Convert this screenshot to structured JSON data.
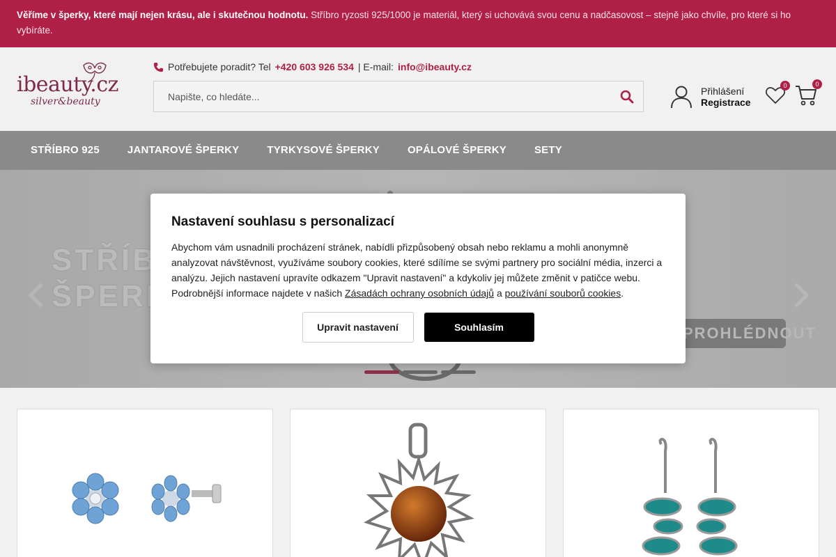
{
  "promo": {
    "bold": "Věříme v šperky, které mají nejen krásu, ale i skutečnou hodnotu.",
    "text": " Stříbro ryzosti 925/1000 je materiál, který si uchovává svou cenu a nadčasovost – stejně jako chvíle, pro které si ho vybíráte."
  },
  "logo": {
    "main": "ibeauty.cz",
    "sub": "silver&beauty"
  },
  "contact": {
    "question": "Potřebujete poradit? Tel",
    "phone": "+420 603 926 534",
    "separator": "| E-mail:",
    "email": "info@ibeauty.cz"
  },
  "search": {
    "placeholder": "Napište, co hledáte..."
  },
  "account": {
    "login": "Přihlášení",
    "register": "Registrace"
  },
  "wishlist": {
    "count": "0"
  },
  "cart": {
    "count": "0"
  },
  "nav": [
    "STŘÍBRO 925",
    "JANTAROVÉ ŠPERKY",
    "TYRKYSOVÉ ŠPERKY",
    "OPÁLOVÉ ŠPERKY",
    "SETY"
  ],
  "hero": {
    "title_line1": "STŘÍBRNÉ",
    "title_line2": "ŠPERKY",
    "cta": "PROHLÉDNOUT",
    "slides": 3,
    "active_slide": 1
  },
  "modal": {
    "title": "Nastavení souhlasu s personalizací",
    "text": "Abychom vám usnadnili procházení stránek, nabídli přizpůsobený obsah nebo reklamu a mohli anonymně analyzovat návštěvnost, využíváme soubory cookies, které sdílíme se svými partnery pro sociální média, inzerci a analýzu. Jejich nastavení upravíte odkazem \"Upravit nastavení\" a kdykoliv jej můžete změnit v patičce webu. Podrobnější informace najdete v našich ",
    "link1": "Zásadách ochrany osobních údajů",
    "and": " a ",
    "link2": "používání souborů cookies",
    "end": ".",
    "settings_button": "Upravit nastavení",
    "accept_button": "Souhlasím"
  },
  "colors": {
    "brand": "#b01f45",
    "nav": "#8a8a8a",
    "header_bg": "#f1f1f1"
  },
  "products": [
    {
      "image": "blue-flower-stud-earrings"
    },
    {
      "image": "amber-sun-pendant"
    },
    {
      "image": "turquoise-drop-earrings"
    }
  ]
}
